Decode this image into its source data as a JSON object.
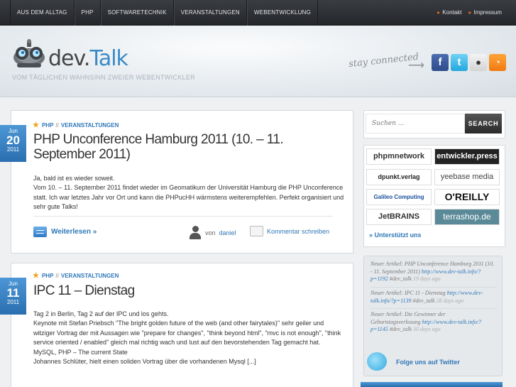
{
  "nav": {
    "items": [
      "AUS DEM ALLTAG",
      "PHP",
      "SOFTWARETECHNIK",
      "VERANSTALTUNGEN",
      "WEBENTWICKLUNG"
    ],
    "top_links": [
      "Kontakt",
      "Impressum"
    ]
  },
  "header": {
    "logo_main": "dev.",
    "logo_accent": "Talk",
    "tagline": "VOM TÄGLICHEN WAHNSINN ZWEIER WEBENTWICKLER",
    "stay_connected": "stay connected"
  },
  "posts": [
    {
      "date": {
        "month": "Jun",
        "day": "20",
        "year": "2011"
      },
      "categories": [
        "PHP",
        "VERANSTALTUNGEN"
      ],
      "title": "PHP Unconference Hamburg 2011 (10. – 11. September 2011)",
      "body": [
        "Ja, bald ist es wieder soweit.",
        "Vom 10. – 11. September 2011 findet wieder im Geomatikum der Universität Hamburg die PHP Unconference statt. Ich war letztes Jahr vor Ort und kann die PHPucHH wärmstens weiterempfehlen. Perfekt organisiert und sehr gute Talks!"
      ],
      "read_more": "Weiterlesen »",
      "by": "von",
      "author": "daniel",
      "comment": "Kommentar schreiben"
    },
    {
      "date": {
        "month": "Jun",
        "day": "11",
        "year": "2011"
      },
      "categories": [
        "PHP",
        "VERANSTALTUNGEN"
      ],
      "title": "IPC 11 – Dienstag",
      "body": [
        "Tag 2 in Berlin, Tag 2 auf der IPC und los gehts.",
        "Keynote mit Stefan Priebsch \"The bright golden future of the web (and other fairytales)\" sehr geiler und witziger Vortrag der mit Aussagen wie \"prepare for changes\", \"think beyond html\", \"mvc is not enough\", \"think service oriented / enabled\" gleich mal richtig wach und lust auf den bevorstehenden Tag gemacht hat.",
        "MySQL, PHP – The current State",
        "Johannes Schlüter, hielt einen soliden Vortrag über die vorhandenen Mysql [...]"
      ]
    }
  ],
  "search": {
    "placeholder": "Suchen ...",
    "button": "SEARCH"
  },
  "sponsors": [
    "phpmnetwork",
    "entwickler.press",
    "dpunkt.verlag",
    "yeebase media",
    "Galileo Computing",
    "O'REILLY",
    "JetBRAINS",
    "terrashop.de"
  ],
  "supporters_link": "» Unterstützt uns",
  "tweets": [
    {
      "text": "Neuer Artikel: PHP Unconference Hamburg 2011 (10. - 11. September 2011)",
      "link": "http://www.dev-talk.info/?p=1192",
      "tag": "#dev_talk",
      "ago": "19 days ago"
    },
    {
      "text": "Neuer Artikel: IPC 11 - Dienstag",
      "link": "http://www.dev-talk.info/?p=1139",
      "tag": "#dev_talk",
      "ago": "28 days ago"
    },
    {
      "text": "Neuer Artikel: Die Gewinner der Geburtstagsverlosung",
      "link": "http://www.dev-talk.info/?p=1145",
      "tag": "#dev_talk",
      "ago": "30 days ago"
    }
  ],
  "follow": "Folge uns auf Twitter",
  "colors": {
    "accent": "#2f78b8",
    "nav_bg": "#2d2f33",
    "date_bg": "#3a86c8",
    "star": "#f0a020"
  }
}
